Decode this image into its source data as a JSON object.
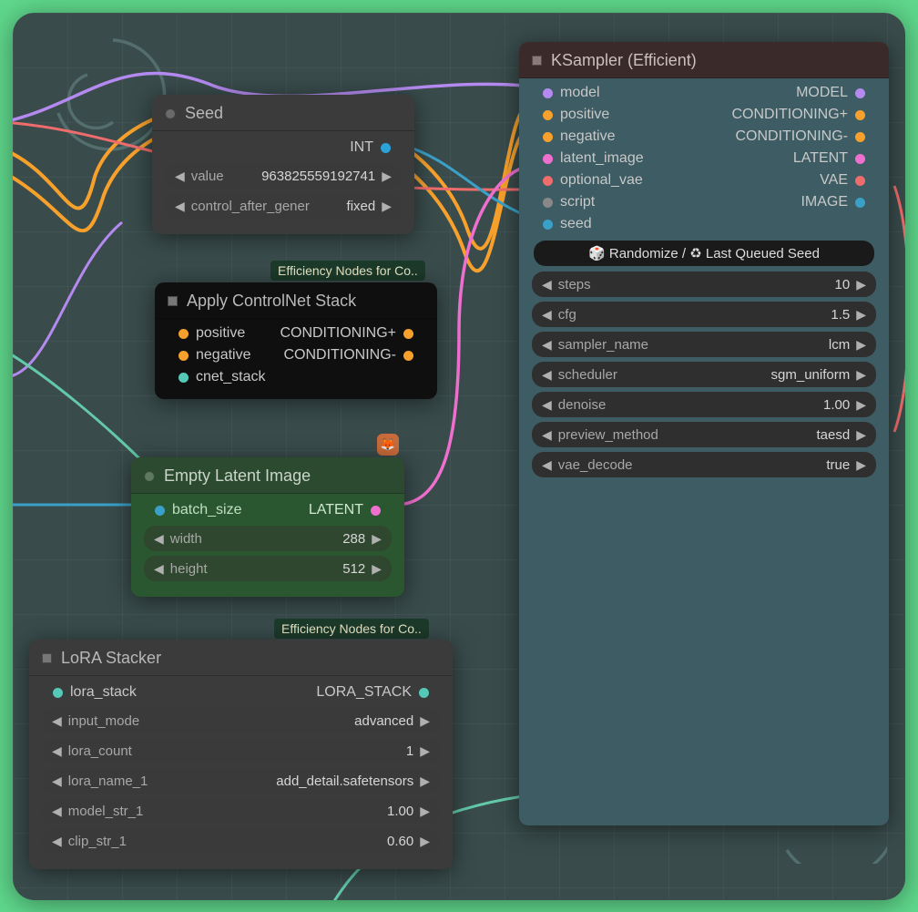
{
  "badges": {
    "eff1": "Efficiency Nodes for Co..",
    "eff2": "Efficiency Nodes for Co.."
  },
  "nodes": {
    "seed": {
      "title": "Seed",
      "outputs": [
        {
          "label": "",
          "type": "INT",
          "color": "#2aa3d8"
        }
      ],
      "widgets": [
        {
          "label": "value",
          "value": "963825559192741"
        },
        {
          "label": "control_after_gener",
          "value": "fixed"
        }
      ]
    },
    "controlnet": {
      "title": "Apply ControlNet Stack",
      "ios": [
        {
          "label": "positive",
          "type": "CONDITIONING+",
          "color": "#f7a12c"
        },
        {
          "label": "negative",
          "type": "CONDITIONING-",
          "color": "#f7a12c"
        },
        {
          "label": "cnet_stack",
          "type": "",
          "color": "#55c9b7"
        }
      ]
    },
    "latent": {
      "title": "Empty Latent Image",
      "inputs": [
        {
          "label": "batch_size",
          "color": "#3aa0c8"
        }
      ],
      "outputs": [
        {
          "type": "LATENT",
          "color": "#ef6fcf"
        }
      ],
      "widgets": [
        {
          "label": "width",
          "value": "288"
        },
        {
          "label": "height",
          "value": "512"
        }
      ]
    },
    "lora": {
      "title": "LoRA Stacker",
      "inputs": [
        {
          "label": "lora_stack",
          "color": "#55c9b7"
        }
      ],
      "outputs": [
        {
          "type": "LORA_STACK",
          "color": "#55c9b7"
        }
      ],
      "widgets": [
        {
          "label": "input_mode",
          "value": "advanced"
        },
        {
          "label": "lora_count",
          "value": "1"
        },
        {
          "label": "lora_name_1",
          "value": "add_detail.safetensors"
        },
        {
          "label": "model_str_1",
          "value": "1.00"
        },
        {
          "label": "clip_str_1",
          "value": "0.60"
        }
      ]
    },
    "ksampler": {
      "title": "KSampler (Efficient)",
      "ios": [
        {
          "label": "model",
          "type": "MODEL",
          "color": "#b58af0"
        },
        {
          "label": "positive",
          "type": "CONDITIONING+",
          "color": "#f7a12c"
        },
        {
          "label": "negative",
          "type": "CONDITIONING-",
          "color": "#f7a12c"
        },
        {
          "label": "latent_image",
          "type": "LATENT",
          "color": "#ef6fcf"
        },
        {
          "label": "optional_vae",
          "type": "VAE",
          "color": "#ee6c6c"
        },
        {
          "label": "script",
          "type": "IMAGE",
          "color": "#3aa0c8"
        },
        {
          "label": "seed",
          "type": "",
          "color": "#3aa0c8"
        }
      ],
      "button": "🎲 Randomize / ♻ Last Queued Seed",
      "widgets": [
        {
          "label": "steps",
          "value": "10"
        },
        {
          "label": "cfg",
          "value": "1.5"
        },
        {
          "label": "sampler_name",
          "value": "lcm"
        },
        {
          "label": "scheduler",
          "value": "sgm_uniform"
        },
        {
          "label": "denoise",
          "value": "1.00"
        },
        {
          "label": "preview_method",
          "value": "taesd"
        },
        {
          "label": "vae_decode",
          "value": "true"
        }
      ]
    }
  }
}
